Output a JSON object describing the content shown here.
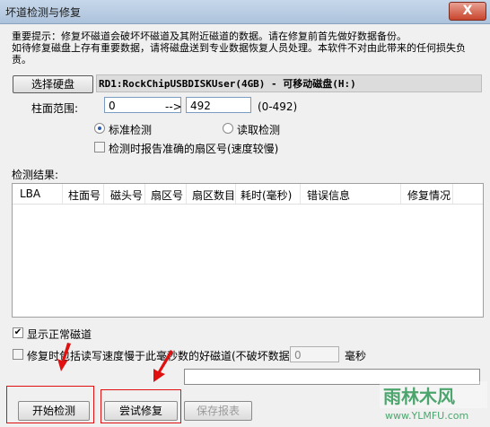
{
  "window": {
    "title": "坏道检测与修复",
    "close_label": "X"
  },
  "notice": {
    "line1": "重要提示：修复坏磁道会破坏坏磁道及其附近磁道的数据。请在修复前首先做好数据备份。",
    "line2": "如待修复磁盘上存有重要数据，请将磁盘送到专业数据恢复人员处理。本软件不对由此带来的任何损失负责。"
  },
  "disk": {
    "select_label": "选择硬盘",
    "info": "RD1:RockChipUSBDISKUser(4GB) - 可移动磁盘(H:)"
  },
  "cylinder": {
    "label": "柱面范围:",
    "from": "0",
    "arrow": "-->",
    "to": "492",
    "range_hint": "(0-492)"
  },
  "mode": {
    "standard": "标准检测",
    "read": "读取检测",
    "selected": "standard"
  },
  "report_sector": {
    "label": "检测时报告准确的扇区号(速度较慢)",
    "checked": false
  },
  "results": {
    "label": "检测结果:",
    "columns": [
      "LBA",
      "柱面号",
      "磁头号",
      "扇区号",
      "扇区数目",
      "耗时(毫秒)",
      "错误信息",
      "修复情况"
    ],
    "rows": []
  },
  "show_normal": {
    "label": "显示正常磁道",
    "checked": true
  },
  "repair_slow": {
    "label": "修复时包括读写速度慢于此毫秒数的好磁道(不破坏数据):",
    "value": "0",
    "unit": "毫秒",
    "checked": false
  },
  "buttons": {
    "start": "开始检测",
    "try_repair": "尝试修复",
    "save_report": "保存报表"
  },
  "watermark": {
    "brand": "雨林木风",
    "url": "www.YLMFU.com"
  }
}
